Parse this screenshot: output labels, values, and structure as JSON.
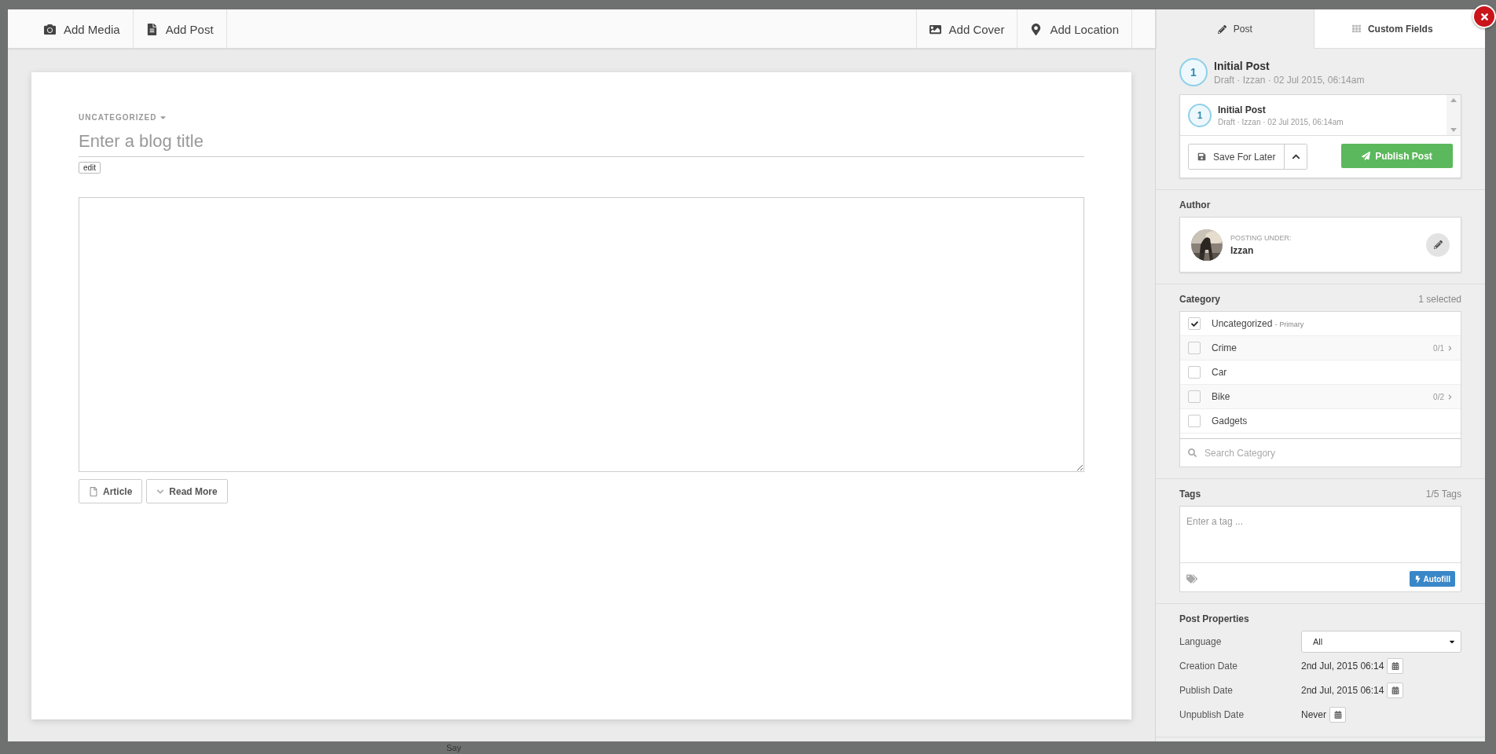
{
  "toolbar": {
    "left": [
      {
        "label": "Add Media"
      },
      {
        "label": "Add Post"
      }
    ],
    "right": [
      {
        "label": "Add Cover"
      },
      {
        "label": "Add Location"
      }
    ]
  },
  "editor": {
    "category": "UNCATEGORIZED",
    "title_placeholder": "Enter a blog title",
    "edit_label": "edit",
    "buttons": [
      {
        "label": "Article"
      },
      {
        "label": "Read More"
      }
    ]
  },
  "sidebar": {
    "tabs": [
      {
        "label": "Post",
        "selected": true
      },
      {
        "label": "Custom Fields",
        "selected": false
      }
    ],
    "revision": {
      "number": "1",
      "title": "Initial Post",
      "meta": "Draft · Izzan · 02 Jul 2015, 06:14am"
    },
    "revisions": [
      {
        "number": "1",
        "title": "Initial Post",
        "meta": "Draft · Izzan · 02 Jul 2015, 06:14am"
      }
    ],
    "save_label": "Save For Later",
    "publish_label": "Publish Post",
    "author": {
      "heading": "Author",
      "caption": "POSTING UNDER:",
      "name": "Izzan"
    },
    "category": {
      "heading": "Category",
      "count": "1 selected",
      "items": [
        {
          "label": "Uncategorized",
          "note": "- Primary",
          "checked": true
        },
        {
          "label": "Crime",
          "children_count": "0/1",
          "checked": false
        },
        {
          "label": "Car",
          "checked": false
        },
        {
          "label": "Bike",
          "children_count": "0/2",
          "checked": false
        },
        {
          "label": "Gadgets",
          "checked": false
        }
      ],
      "search_placeholder": "Search Category"
    },
    "tags": {
      "heading": "Tags",
      "count": "1/5 Tags",
      "placeholder": "Enter a tag ...",
      "autofill_label": "Autofill"
    },
    "properties": {
      "heading": "Post Properties",
      "rows": [
        {
          "kind": "select",
          "label": "Language",
          "value": "All"
        },
        {
          "kind": "date",
          "label": "Creation Date",
          "value": "2nd Jul, 2015 06:14"
        },
        {
          "kind": "date",
          "label": "Publish Date",
          "value": "2nd Jul, 2015 06:14"
        },
        {
          "kind": "date",
          "label": "Unpublish Date",
          "value": "Never"
        }
      ]
    }
  },
  "background_text": "Say"
}
